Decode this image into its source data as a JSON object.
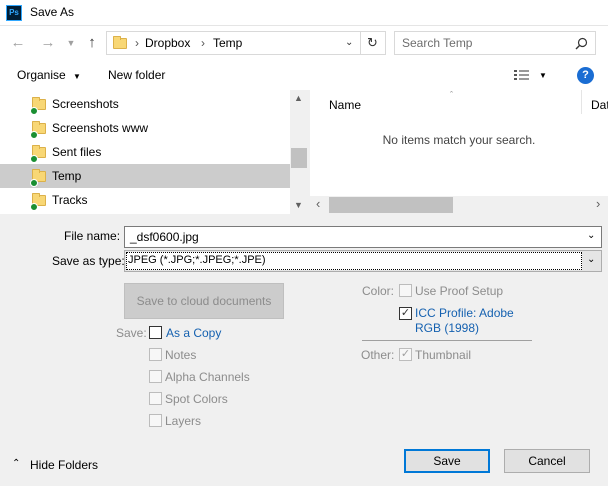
{
  "window": {
    "title": "Save As",
    "app_icon": "Ps"
  },
  "nav": {
    "breadcrumb": [
      "Dropbox",
      "Temp"
    ],
    "search_placeholder": "Search Temp"
  },
  "commands": {
    "organise": "Organise",
    "new_folder": "New folder"
  },
  "tree": [
    {
      "label": "Screenshots",
      "selected": false
    },
    {
      "label": "Screenshots www",
      "selected": false
    },
    {
      "label": "Sent files",
      "selected": false
    },
    {
      "label": "Temp",
      "selected": true
    },
    {
      "label": "Tracks",
      "selected": false
    }
  ],
  "file_list": {
    "columns": [
      "Name",
      "Dat"
    ],
    "empty_message": "No items match your search."
  },
  "form": {
    "file_name_label": "File name:",
    "file_name_value": "_dsf0600.jpg",
    "save_as_type_label": "Save as type:",
    "save_as_type_value": "JPEG (*.JPG;*.JPEG;*.JPE)",
    "cloud_button": "Save to cloud documents",
    "save_label": "Save:",
    "as_copy": "As a Copy",
    "notes": "Notes",
    "alpha_channels": "Alpha Channels",
    "spot_colors": "Spot Colors",
    "layers": "Layers",
    "color_label": "Color:",
    "use_proof_setup": "Use Proof Setup",
    "icc_profile_line1": "ICC Profile:  Adobe",
    "icc_profile_line2": "RGB (1998)",
    "other_label": "Other:",
    "thumbnail": "Thumbnail"
  },
  "footer": {
    "hide_folders": "Hide Folders",
    "save_button": "Save",
    "cancel_button": "Cancel"
  },
  "colors": {
    "accent": "#0078d7",
    "selected_row": "#cccccc",
    "help_icon": "#1a6dd3"
  }
}
